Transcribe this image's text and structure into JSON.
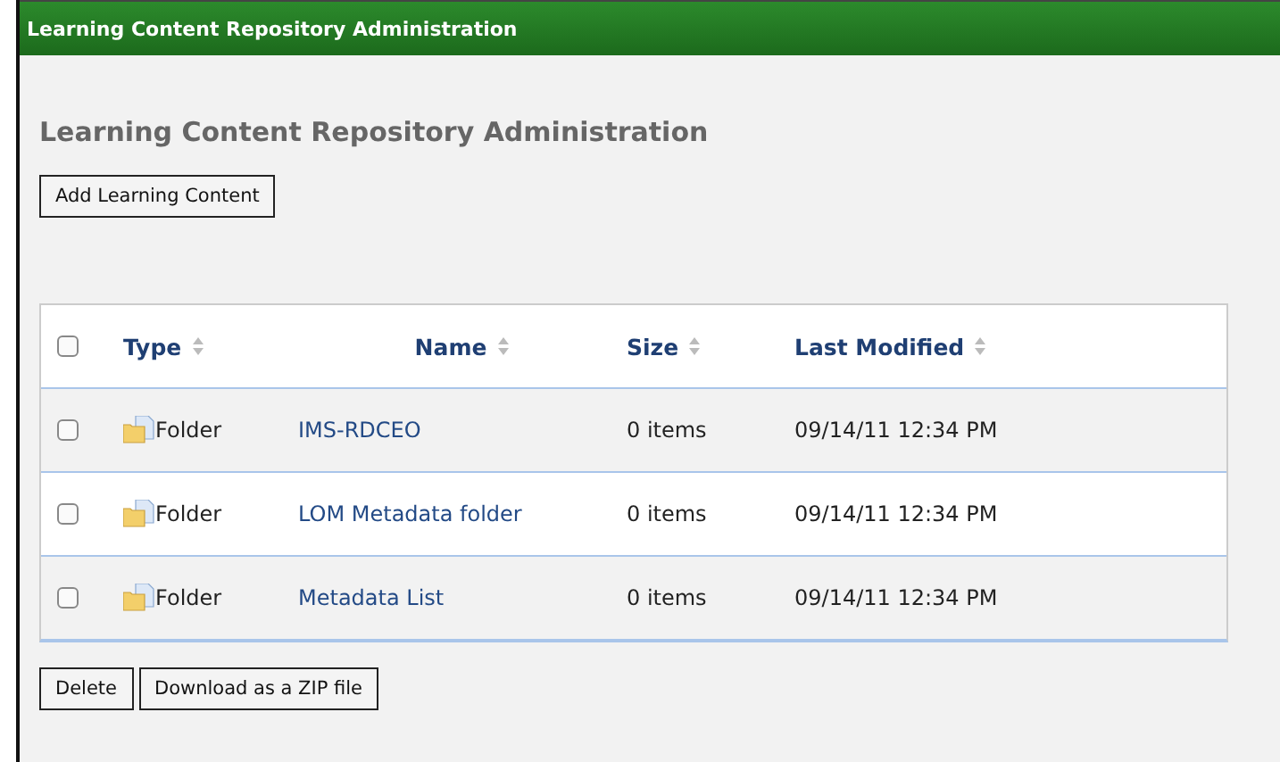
{
  "window": {
    "title": "Learning Content Repository Administration"
  },
  "heading": "Learning Content Repository Administration",
  "add_button": "Add Learning Content",
  "table": {
    "select_all": {
      "checked": false
    },
    "columns": [
      {
        "label": "Type"
      },
      {
        "label": "Name"
      },
      {
        "label": "Size"
      },
      {
        "label": "Last Modified"
      }
    ],
    "rows": [
      {
        "checked": false,
        "type": "Folder",
        "name": "IMS-RDCEO",
        "size": "0 items",
        "modified": "09/14/11 12:34 PM"
      },
      {
        "checked": false,
        "type": "Folder",
        "name": "LOM Metadata folder",
        "size": "0 items",
        "modified": "09/14/11 12:34 PM"
      },
      {
        "checked": false,
        "type": "Folder",
        "name": "Metadata List",
        "size": "0 items",
        "modified": "09/14/11 12:34 PM"
      }
    ]
  },
  "buttons": [
    "Delete",
    "Download as a ZIP file"
  ]
}
